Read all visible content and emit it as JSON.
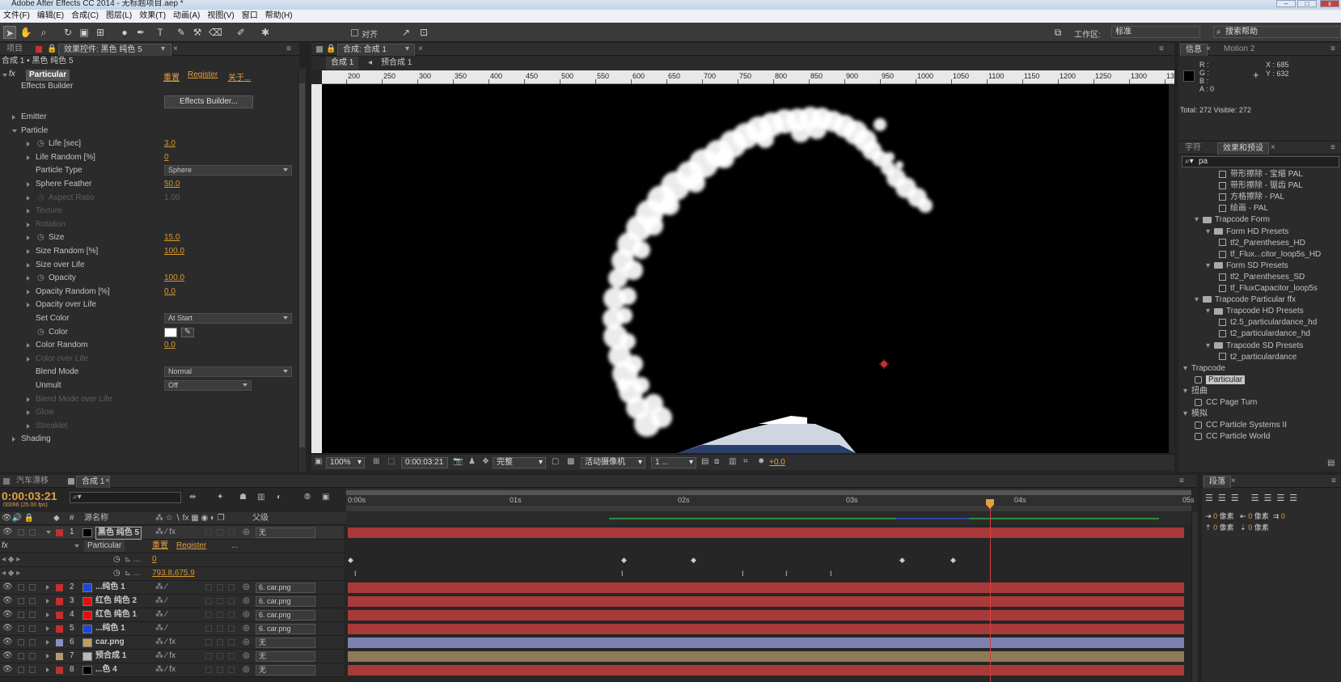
{
  "app": {
    "title": "Adobe After Effects CC 2014 - 无标题项目.aep *",
    "menu": [
      "文件(F)",
      "编辑(E)",
      "合成(C)",
      "图层(L)",
      "效果(T)",
      "动画(A)",
      "视图(V)",
      "窗口",
      "帮助(H)"
    ]
  },
  "toolbar": {
    "align_label": "对齐",
    "workspace_label": "工作区:",
    "workspace_value": "标准",
    "search_placeholder": "搜索帮助"
  },
  "left_panel": {
    "tab_project": "项目",
    "tab_effects": "效果控件: 黑色 纯色 5",
    "breadcrumb": "合成 1 • 黑色 纯色 5",
    "effect_name": "Particular",
    "effect_links": [
      "重置",
      "Register",
      "关于..."
    ],
    "effects_builder_label": "Effects Builder",
    "effects_builder_button": "Effects Builder...",
    "rows": [
      {
        "label": "Emitter",
        "value": ""
      },
      {
        "label": "Particle",
        "value": ""
      },
      {
        "label": "Life [sec]",
        "value": "3.0"
      },
      {
        "label": "Life Random [%]",
        "value": "0"
      },
      {
        "label": "Particle Type",
        "value": "Sphere"
      },
      {
        "label": "Sphere Feather",
        "value": "50.0"
      },
      {
        "label": "Aspect Ratio",
        "value": "1.00"
      },
      {
        "label": "Texture",
        "value": ""
      },
      {
        "label": "Rotation",
        "value": ""
      },
      {
        "label": "Size",
        "value": "15.0"
      },
      {
        "label": "Size Random [%]",
        "value": "100.0"
      },
      {
        "label": "Size over Life",
        "value": ""
      },
      {
        "label": "Opacity",
        "value": "100.0"
      },
      {
        "label": "Opacity Random [%]",
        "value": "0.0"
      },
      {
        "label": "Opacity over Life",
        "value": ""
      },
      {
        "label": "Set Color",
        "value": "At Start"
      },
      {
        "label": "Color",
        "value": ""
      },
      {
        "label": "Color Random",
        "value": "0.0"
      },
      {
        "label": "Color over Life",
        "value": ""
      },
      {
        "label": "Blend Mode",
        "value": "Normal"
      },
      {
        "label": "Unmult",
        "value": "Off"
      },
      {
        "label": "Blend Mode over Life",
        "value": ""
      },
      {
        "label": "Glow",
        "value": ""
      },
      {
        "label": "Streaklet",
        "value": ""
      },
      {
        "label": "Shading",
        "value": ""
      }
    ]
  },
  "composition": {
    "tab": "合成: 合成 1",
    "crumb_comp": "合成 1",
    "crumb_pre": "预合成 1",
    "ruler": [
      "200",
      "250",
      "300",
      "350",
      "400",
      "450",
      "500",
      "550",
      "600",
      "650",
      "700",
      "750",
      "800",
      "850",
      "900",
      "950",
      "1000",
      "1050",
      "1100",
      "1150",
      "1200",
      "1250",
      "1300",
      "13"
    ],
    "zoom": "100%",
    "timecode": "0:00:03:21",
    "quality": "完整",
    "camera": "活动摄像机",
    "views": "1 ...",
    "exposure": "+0.0"
  },
  "info_panel": {
    "tab_info": "信息",
    "tab_motion": "Motion 2",
    "r": "R :",
    "g": "G :",
    "b": "B :",
    "a": "A : 0",
    "x": "X : 685",
    "y": "Y : 632",
    "total": "Total: 272  Visible: 272"
  },
  "effects_presets": {
    "tab_char": "字符",
    "tab_effects": "效果和预设",
    "search_value": "pa",
    "items": [
      {
        "label": "带形擦除 - 宝缩 PAL",
        "level": 3,
        "type": "doc"
      },
      {
        "label": "带形擦除 - 锯齿 PAL",
        "level": 3,
        "type": "doc"
      },
      {
        "label": "方格擦除 - PAL",
        "level": 3,
        "type": "doc"
      },
      {
        "label": "绘画 - PAL",
        "level": 3,
        "type": "doc"
      },
      {
        "label": "Trapcode Form",
        "level": 1,
        "type": "folder"
      },
      {
        "label": "Form HD Presets",
        "level": 2,
        "type": "folder"
      },
      {
        "label": "tf2_Parentheses_HD",
        "level": 3,
        "type": "doc"
      },
      {
        "label": "tf_Flux...citor_loop5s_HD",
        "level": 3,
        "type": "doc"
      },
      {
        "label": "Form SD Presets",
        "level": 2,
        "type": "folder"
      },
      {
        "label": "tf2_Parentheses_SD",
        "level": 3,
        "type": "doc"
      },
      {
        "label": "tf_FluxCapacitor_loop5s",
        "level": 3,
        "type": "doc"
      },
      {
        "label": "Trapcode Particular ffx",
        "level": 1,
        "type": "folder"
      },
      {
        "label": "Trapcode HD Presets",
        "level": 2,
        "type": "folder"
      },
      {
        "label": "t2.5_particulardance_hd",
        "level": 3,
        "type": "doc"
      },
      {
        "label": "t2_particulardance_hd",
        "level": 3,
        "type": "doc"
      },
      {
        "label": "Trapcode SD Presets",
        "level": 2,
        "type": "folder"
      },
      {
        "label": "t2_particulardance",
        "level": 3,
        "type": "doc"
      },
      {
        "label": "Trapcode",
        "level": 0,
        "type": "group"
      },
      {
        "label": "Particular",
        "level": 1,
        "type": "effect",
        "selected": true
      },
      {
        "label": "扭曲",
        "level": 0,
        "type": "group"
      },
      {
        "label": "CC Page Turn",
        "level": 1,
        "type": "effect"
      },
      {
        "label": "模拟",
        "level": 0,
        "type": "group"
      },
      {
        "label": "CC Particle Systems II",
        "level": 1,
        "type": "effect"
      },
      {
        "label": "CC Particle World",
        "level": 1,
        "type": "effect"
      }
    ]
  },
  "timeline": {
    "tab1": "汽车漂移",
    "tab2": "合成 1",
    "timecode": "0:00:03:21",
    "frames": "00096 (25.00 fps)",
    "col_source": "源名称",
    "col_parent": "父级",
    "time_labels": [
      "0:00s",
      "01s",
      "02s",
      "03s",
      "04s",
      "05s"
    ],
    "sub_particular": "Particular",
    "sub_reset": "重置",
    "sub_register": "Register",
    "sub_dots": "...",
    "prop1_value": "0",
    "prop2_value": "793.8,675.9",
    "layers": [
      {
        "num": "1",
        "name": "黑色 纯色 5",
        "color": "#c23030",
        "thumb": "#000000",
        "parent": "无",
        "selected": true
      },
      {
        "num": "2",
        "name": "...纯色 1",
        "color": "#c23030",
        "thumb": "#1f46d8",
        "parent": "6. car.png"
      },
      {
        "num": "3",
        "name": "红色 纯色 2",
        "color": "#c23030",
        "thumb": "#e01010",
        "parent": "6. car.png"
      },
      {
        "num": "4",
        "name": "红色 纯色 1",
        "color": "#c23030",
        "thumb": "#e01010",
        "parent": "6. car.png"
      },
      {
        "num": "5",
        "name": "...纯色 1",
        "color": "#c23030",
        "thumb": "#1f46d8",
        "parent": "6. car.png"
      },
      {
        "num": "6",
        "name": "car.png",
        "color": "#8a8fc0",
        "thumb": "#c0a060",
        "parent": "无"
      },
      {
        "num": "7",
        "name": "预合成 1",
        "color": "#b59a70",
        "thumb": "#bbbbbb",
        "parent": "无"
      },
      {
        "num": "8",
        "name": "...色 4",
        "color": "#c23030",
        "thumb": "#000000",
        "parent": "无"
      }
    ],
    "progress": 0.77
  },
  "paragraph_panel": {
    "tab": "段落",
    "unit": "像素",
    "zero": "0"
  },
  "colors": {
    "accent": "#e3a13d",
    "layer_red": "#a83a3a",
    "layer_blue": "#7d80b0",
    "layer_tan": "#8f7a57"
  }
}
